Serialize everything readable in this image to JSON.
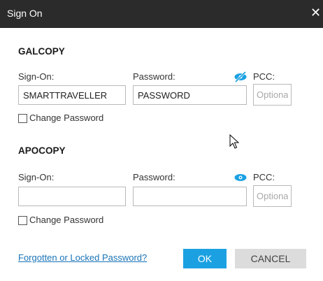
{
  "window": {
    "title": "Sign On",
    "close_icon": "close-icon"
  },
  "galcopy": {
    "heading": "GALCOPY",
    "sign_on_label": "Sign-On:",
    "sign_on_value": "SMARTTRAVELLER",
    "password_label": "Password:",
    "password_value": "PASSWORD",
    "password_icon": "eye-slash-icon",
    "pcc_label": "PCC:",
    "pcc_placeholder": "Optional",
    "change_password_label": "Change Password",
    "change_password_checked": false
  },
  "apocopy": {
    "heading": "APOCOPY",
    "sign_on_label": "Sign-On:",
    "sign_on_value": "",
    "password_label": "Password:",
    "password_value": "",
    "password_icon": "eye-icon",
    "pcc_label": "PCC:",
    "pcc_placeholder": "Optional",
    "change_password_label": "Change Password",
    "change_password_checked": false
  },
  "footer": {
    "forgot_link": "Forgotten or Locked Password?",
    "ok_label": "OK",
    "cancel_label": "CANCEL"
  },
  "colors": {
    "titlebar": "#2b2b2b",
    "accent": "#1ba1e2",
    "link": "#1a73b6",
    "cancel_bg": "#dcdcdc"
  }
}
